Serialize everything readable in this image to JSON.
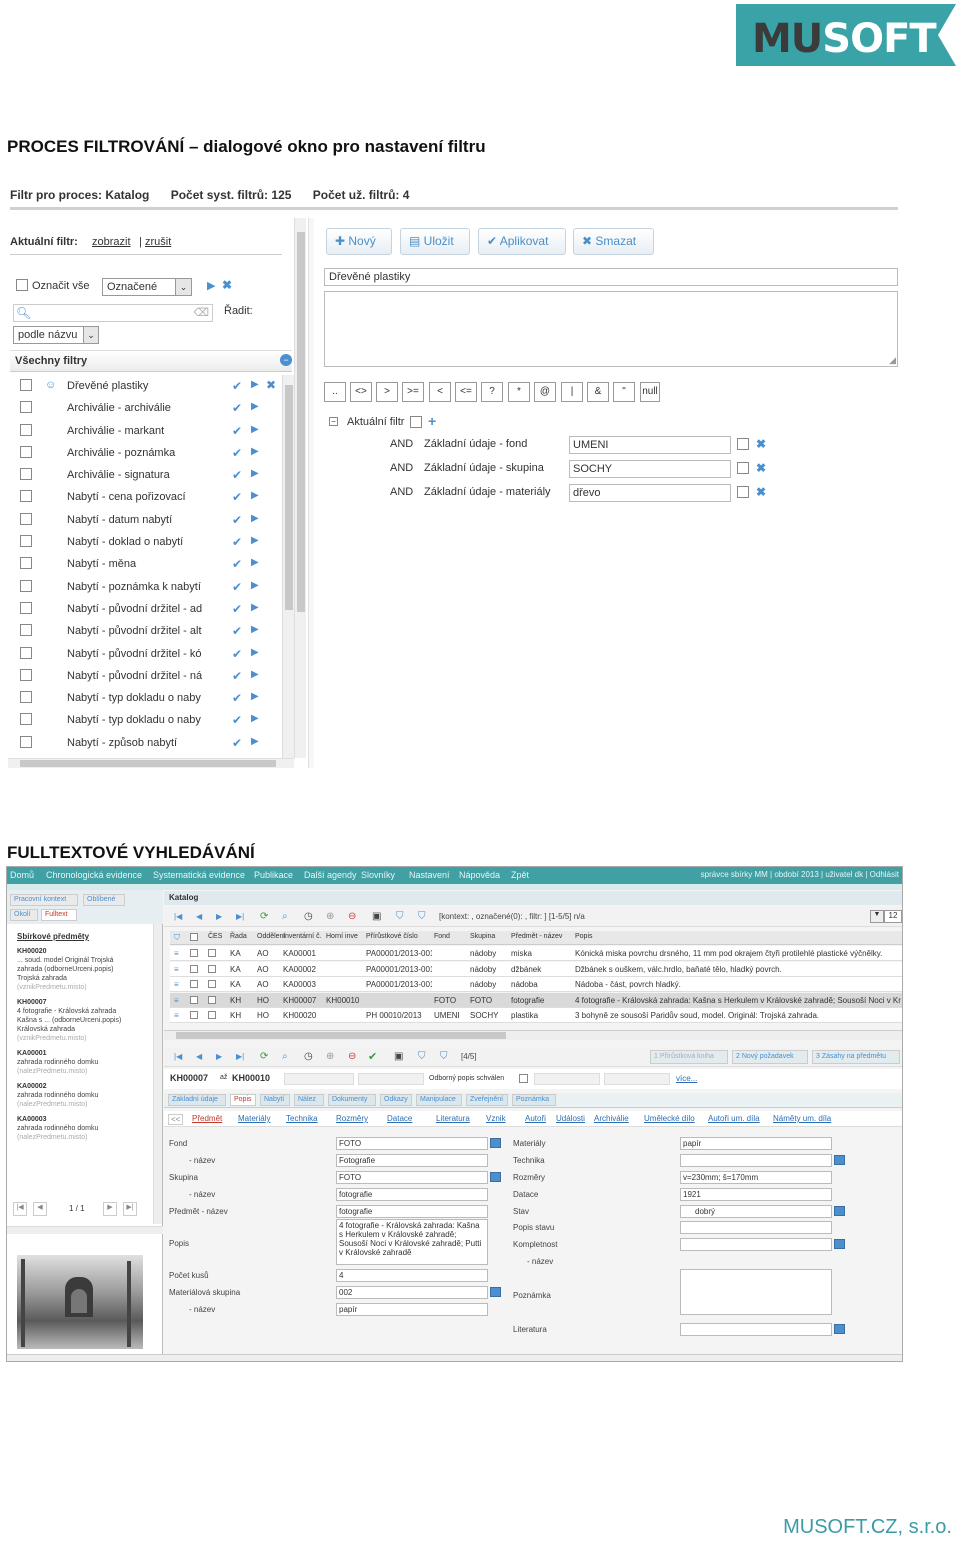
{
  "logo": {
    "text_mu": "MU",
    "text_soft": "SOFT",
    "color": "#3aa3a8"
  },
  "heading1": "PROCES FILTROVÁNÍ – dialogové okno pro nastavení filtru",
  "heading2": "FULLTEXTOVÉ VYHLEDÁVÁNÍ",
  "footer": "MUSOFT.CZ, s.r.o.",
  "filter_dialog": {
    "title_process": "Filtr pro proces:  Katalog",
    "sys_count": "Počet syst. filtrů:  125",
    "user_count": "Počet už. filtrů:  4",
    "current_label": "Aktuální filtr:",
    "show_link": "zobrazit",
    "cancel_link": "zrušit",
    "select_all": "Označit vše",
    "select_value": "Označené",
    "sort_label": "Řadit:",
    "sort_value": "podle názvu",
    "all_filters": "Všechny filtry",
    "filters": [
      "Dřevěné plastiky",
      "Archiválie - archiválie",
      "Archiválie - markant",
      "Archiválie - poznámka",
      "Archiválie - signatura",
      "Nabytí - cena pořizovací",
      "Nabytí - datum nabytí",
      "Nabytí - doklad o nabytí",
      "Nabytí - měna",
      "Nabytí - poznámka k nabytí",
      "Nabytí - původní držitel - ad",
      "Nabytí - původní držitel - alt",
      "Nabytí - původní držitel - kó",
      "Nabytí - původní držitel - ná",
      "Nabytí - typ dokladu o naby",
      "Nabytí - typ dokladu o naby",
      "Nabytí - způsob nabytí"
    ],
    "buttons": {
      "new": "Nový",
      "save": "Uložit",
      "apply": "Aplikovat",
      "delete": "Smazat"
    },
    "filter_name": "Dřevěné plastiky",
    "operators": [
      "..",
      "<>",
      ">",
      ">=",
      "<",
      "<=",
      "?",
      "*",
      "@",
      "|",
      "&",
      "\"",
      "null"
    ],
    "current_filter": "Aktuální filtr",
    "conditions": [
      {
        "op": "AND",
        "field": "Základní údaje - fond",
        "value": "UMENI"
      },
      {
        "op": "AND",
        "field": "Základní údaje - skupina",
        "value": "SOCHY"
      },
      {
        "op": "AND",
        "field": "Základní údaje - materiály",
        "value": "dřevo"
      }
    ]
  },
  "app": {
    "nav": [
      "Domů",
      "Chronologická evidence",
      "Systematická evidence",
      "Publikace",
      "Další agendy",
      "Slovníky",
      "Nastavení",
      "Nápověda",
      "Zpět"
    ],
    "nav_right": "správce sbírky MM | období 2013 | uživatel dk | Odhlásit",
    "left_tabs": [
      "Pracovní kontext",
      "Oblíbené",
      "Okolí",
      "Fulltext"
    ],
    "left_title": "Sbírkové předměty",
    "results": [
      {
        "id": "KH00020",
        "lines": [
          "... soud. model Originál Trojská",
          "zahrada (odborneUrceni.popis)",
          "Trojská zahrada",
          "(vznikPredmetu.misto)"
        ]
      },
      {
        "id": "KH00007",
        "lines": [
          "4 fotografie - Královská zahrada",
          "Kašna s ... (odborneUrceni.popis)",
          "Královská zahrada",
          "(vznikPredmetu.misto)"
        ]
      },
      {
        "id": "KA00001",
        "lines": [
          "zahrada rodinného domku",
          "(nalezPredmetu.misto)"
        ]
      },
      {
        "id": "KA00002",
        "lines": [
          "zahrada rodinného domku",
          "(nalezPredmetu.misto)"
        ]
      },
      {
        "id": "KA00003",
        "lines": [
          "zahrada rodinného domku",
          "(nalezPredmetu.misto)"
        ]
      }
    ],
    "pager": "1 / 1",
    "catalog_title": "Katalog",
    "toolbar_text": "[kontext: , označené(0): , filtr: ] [1-5/5]  n/a",
    "page_size": "12",
    "columns": [
      "ČES",
      "Řada",
      "Oddělení",
      "Inventární č.",
      "Horní inve",
      "Přírůstkové číslo",
      "Fond",
      "Skupina",
      "Předmět - název",
      "Popis"
    ],
    "rows": [
      {
        "a": "KA",
        "b": "AO",
        "c": "KA00001",
        "d": "",
        "e": "PA00001/2013-001 A",
        "f": "",
        "g": "nádoby",
        "h": "miska",
        "i": "Kónická miska povrchu drsného, 11 mm pod okrajem čtyři protilehlé plastické výčnělky."
      },
      {
        "a": "KA",
        "b": "AO",
        "c": "KA00002",
        "d": "",
        "e": "PA00001/2013-001 A",
        "f": "",
        "g": "nádoby",
        "h": "džbánek",
        "i": "Džbánek s ouškem, válc.hrdlo, baňaté tělo, hladký povrch."
      },
      {
        "a": "KA",
        "b": "AO",
        "c": "KA00003",
        "d": "",
        "e": "PA00001/2013-001 A",
        "f": "",
        "g": "nádoby",
        "h": "nádoba",
        "i": "Nádoba - část, povrch hladký."
      },
      {
        "a": "KH",
        "b": "HO",
        "c": "KH00007",
        "d": "KH00010",
        "e": "",
        "f": "FOTO",
        "g": "FOTO",
        "h": "fotografie",
        "i": "4 fotografie - Královská zahrada: Kašna s Herkulem v Královské zahradě; Sousoší Noci v Kr"
      },
      {
        "a": "KH",
        "b": "HO",
        "c": "KH00020",
        "d": "",
        "e": "PH 00010/2013",
        "f": "UMENI",
        "g": "SOCHY",
        "h": "plastika",
        "i": "3 bohyně ze sousoší Paridův soud, model. Originál: Trojská zahrada."
      }
    ],
    "detail_pager": "[4/5]",
    "detail_tabs_right": [
      "1 Přírůstková kniha",
      "2 Nový požadavek",
      "3 Zásahy na předmětu"
    ],
    "detail_range_from": "KH00007",
    "detail_range_to": "KH00010",
    "detail_approved": "Odborný popis schválen",
    "detail_more": "více...",
    "detail_tabs": [
      "Základní údaje",
      "Popis",
      "Nabytí",
      "Nález",
      "Dokumenty",
      "Odkazy",
      "Manipulace",
      "Zveřejnění",
      "Poznámka"
    ],
    "subtabs": [
      "Předmět",
      "Materiály",
      "Technika",
      "Rozměry",
      "Datace",
      "Literatura",
      "Vznik",
      "Autoři",
      "Události",
      "Archiválie",
      "Umělecké dílo",
      "Autoři um. díla",
      "Náměty um. díla"
    ],
    "left_fields": [
      {
        "label": "Fond",
        "value": "FOTO"
      },
      {
        "label": "- název",
        "value": "Fotografie"
      },
      {
        "label": "Skupina",
        "value": "FOTO"
      },
      {
        "label": "- název",
        "value": "fotografie"
      },
      {
        "label": "Předmět - název",
        "value": "fotografie"
      },
      {
        "label": "Popis",
        "value": "4 fotografie - Královská zahrada: Kašna s Herkulem v Královské zahradě; Sousoší Noci v Královské zahradě; Putti v Královské zahradě"
      },
      {
        "label": "Počet kusů",
        "value": "4"
      },
      {
        "label": "Materiálová skupina",
        "value": "002"
      },
      {
        "label": "- název",
        "value": "papír"
      }
    ],
    "right_fields": [
      {
        "label": "Materiály",
        "value": "papír"
      },
      {
        "label": "Technika",
        "value": ""
      },
      {
        "label": "Rozměry",
        "value": "v=230mm; š=170mm"
      },
      {
        "label": "Datace",
        "value": "1921"
      },
      {
        "label": "Stav",
        "value": "dobrý"
      },
      {
        "label": "Popis stavu",
        "value": ""
      },
      {
        "label": "Kompletnost",
        "value": ""
      },
      {
        "label": "- název",
        "value": ""
      },
      {
        "label": "Poznámka",
        "value": ""
      },
      {
        "label": "Literatura",
        "value": ""
      }
    ]
  }
}
